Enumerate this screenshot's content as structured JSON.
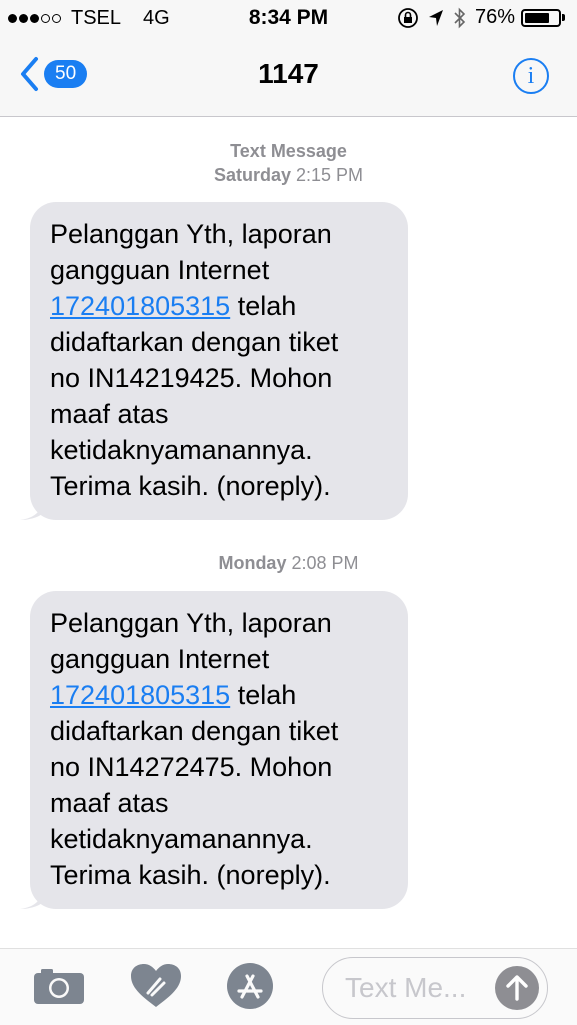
{
  "status": {
    "carrier": "TSEL",
    "network": "4G",
    "time": "8:34 PM",
    "battery_pct": "76%",
    "battery_level": 0.76,
    "signal_bars": 3
  },
  "nav": {
    "back_count": "50",
    "title": "1147",
    "info_glyph": "i"
  },
  "thread": {
    "header_line1": "Text Message",
    "messages": [
      {
        "day": "Saturday",
        "time": "2:15 PM",
        "line1": "Pelanggan Yth, laporan",
        "line2": "gangguan Internet",
        "link": "172401805315",
        "line3_rest": " telah",
        "line4": "didaftarkan dengan tiket",
        "line5": "no IN14219425. Mohon",
        "line6": "maaf atas",
        "line7": "ketidaknyamanannya.",
        "line8": "Terima kasih. (noreply)."
      },
      {
        "day": "Monday",
        "time": "2:08 PM",
        "line1": "Pelanggan Yth, laporan",
        "line2": "gangguan Internet",
        "link": "172401805315",
        "line3_rest": " telah",
        "line4": "didaftarkan dengan tiket",
        "line5": "no IN14272475. Mohon",
        "line6": "maaf atas",
        "line7": "ketidaknyamanannya.",
        "line8": "Terima kasih. (noreply)."
      }
    ]
  },
  "toolbar": {
    "input_placeholder": "Text Me...",
    "icons": [
      "camera-icon",
      "digital-touch-icon",
      "app-store-icon",
      "send-icon"
    ]
  },
  "colors": {
    "accent": "#1a7ef2",
    "bubble": "#e5e5ea",
    "muted": "#8e8e93"
  }
}
